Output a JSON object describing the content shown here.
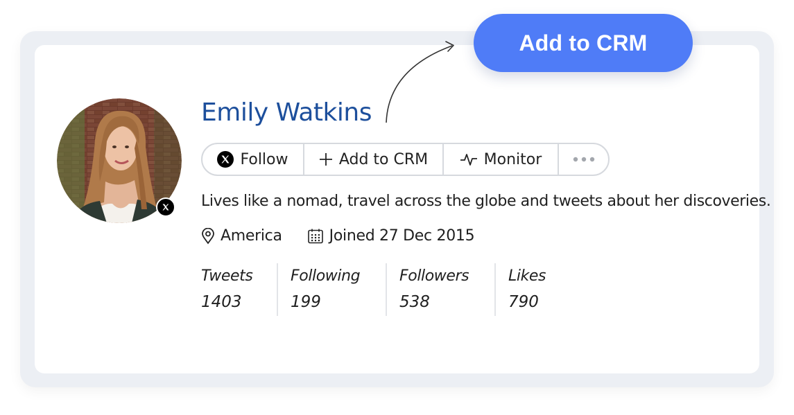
{
  "cta": {
    "label": "Add to CRM"
  },
  "profile": {
    "name": "Emily Watkins",
    "bio": "Lives like a nomad, travel across the globe and tweets about her discoveries.",
    "location": "America",
    "joined": "Joined 27 Dec 2015"
  },
  "actions": {
    "follow_label": "Follow",
    "add_crm_label": "Add to CRM",
    "monitor_label": "Monitor"
  },
  "stats": [
    {
      "label": "Tweets",
      "value": "1403"
    },
    {
      "label": "Following",
      "value": "199"
    },
    {
      "label": "Followers",
      "value": "538"
    },
    {
      "label": "Likes",
      "value": "790"
    }
  ],
  "icons": {
    "follow": "x-logo-icon",
    "add_crm": "plus-icon",
    "monitor": "activity-pulse-icon",
    "more": "more-dots-icon",
    "location": "location-pin-icon",
    "joined": "calendar-icon",
    "badge": "x-logo-icon"
  },
  "colors": {
    "name": "#1d4f9c",
    "cta_background": "#4f7cf7",
    "frame": "#eceff4"
  }
}
